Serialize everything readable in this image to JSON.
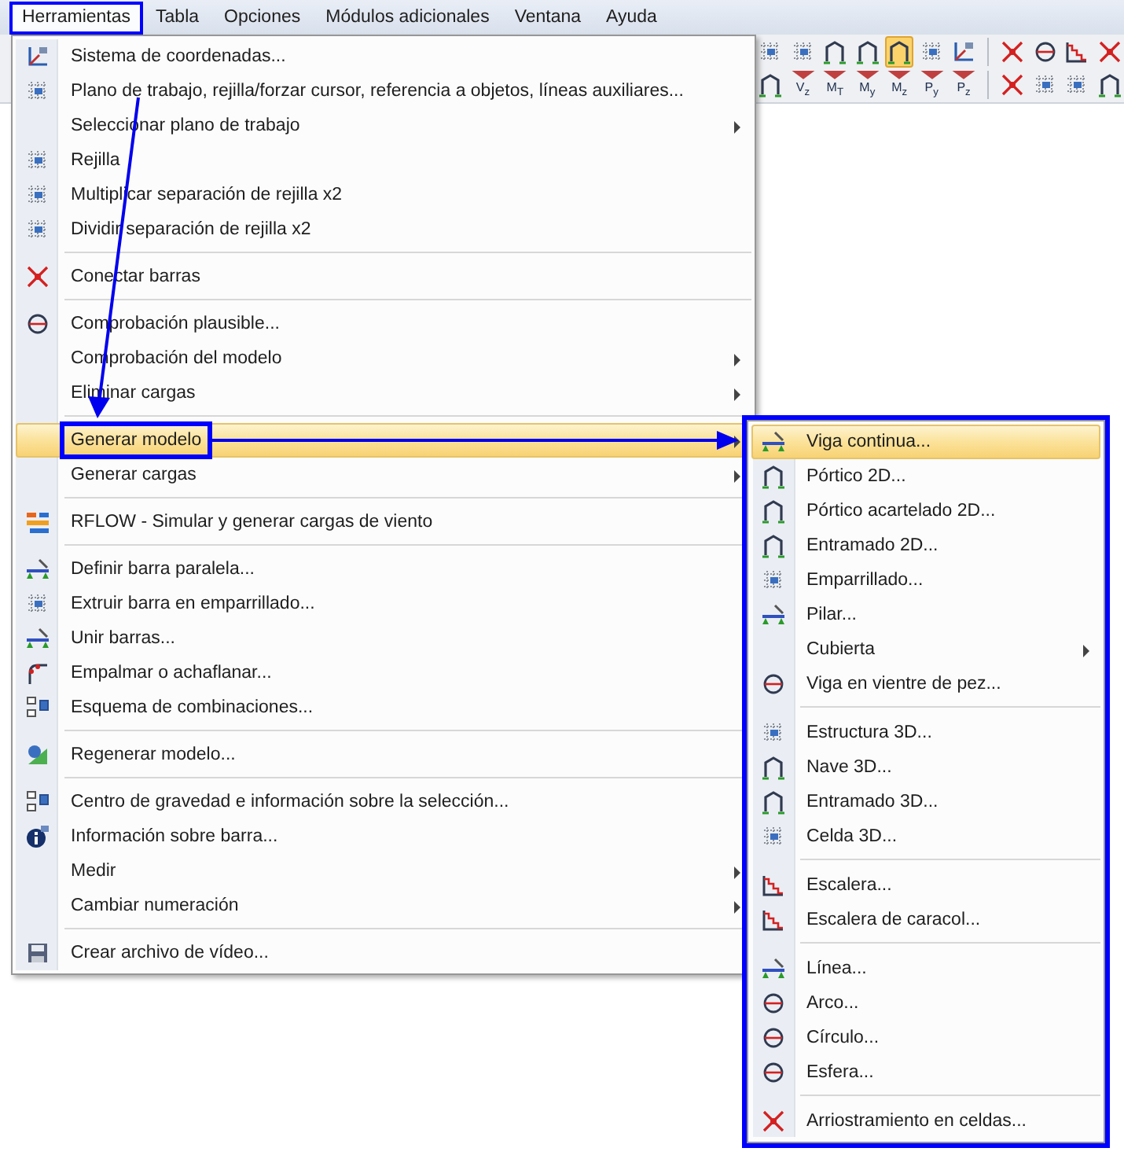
{
  "menubar": [
    {
      "label": "Herramientas",
      "selected": true,
      "framed": true
    },
    {
      "label": "Tabla",
      "selected": false,
      "framed": false
    },
    {
      "label": "Opciones",
      "selected": false,
      "framed": false
    },
    {
      "label": "Módulos adicionales",
      "selected": false,
      "framed": false
    },
    {
      "label": "Ventana",
      "selected": false,
      "framed": false
    },
    {
      "label": "Ayuda",
      "selected": false,
      "framed": false
    }
  ],
  "toolbar": {
    "row_1": [
      {
        "selected": false
      },
      {
        "selected": false
      },
      {
        "selected": false
      },
      {
        "selected": false
      },
      {
        "selected": true
      },
      {
        "selected": false
      },
      {
        "selected": false
      },
      {
        "selected": false
      },
      {
        "selected": false
      },
      {
        "selected": false
      },
      {
        "selected": false
      }
    ],
    "row_2": [
      {
        "kind": "icon",
        "selected": false
      },
      {
        "kind": "label",
        "label": "V$_{z}$",
        "selected": false
      },
      {
        "kind": "label",
        "label": "M$_{T}$",
        "selected": false
      },
      {
        "kind": "label",
        "label": "M$_{y}$",
        "selected": false
      },
      {
        "kind": "label",
        "label": "M$_{z}$",
        "selected": false
      },
      {
        "kind": "label",
        "label": "P$_{y}$",
        "selected": false
      },
      {
        "kind": "label",
        "label": "P$_{z}$",
        "selected": false
      },
      {
        "kind": "icon",
        "selected": false
      },
      {
        "kind": "icon",
        "selected": false
      },
      {
        "kind": "icon",
        "selected": false
      },
      {
        "kind": "icon",
        "selected": false
      }
    ]
  },
  "menu": {
    "items": [
      {
        "kind": "item",
        "label": "Sistema de coordenadas...",
        "submenu": false,
        "selected": false,
        "framed": false
      },
      {
        "kind": "item",
        "label": "Plano de trabajo, rejilla/forzar cursor, referencia a objetos, líneas auxiliares...",
        "submenu": false,
        "selected": false,
        "framed": false
      },
      {
        "kind": "item",
        "label": "Seleccionar plano de trabajo",
        "submenu": true,
        "selected": false,
        "framed": false
      },
      {
        "kind": "item",
        "label": "Rejilla",
        "submenu": false,
        "selected": false,
        "framed": false
      },
      {
        "kind": "item",
        "label": "Multiplicar separación de rejilla x2",
        "submenu": false,
        "selected": false,
        "framed": false
      },
      {
        "kind": "item",
        "label": "Dividir separación de rejilla x2",
        "submenu": false,
        "selected": false,
        "framed": false
      },
      {
        "kind": "separator"
      },
      {
        "kind": "item",
        "label": "Conectar barras",
        "submenu": false,
        "selected": false,
        "framed": false
      },
      {
        "kind": "separator"
      },
      {
        "kind": "item",
        "label": "Comprobación plausible...",
        "submenu": false,
        "selected": false,
        "framed": false
      },
      {
        "kind": "item",
        "label": "Comprobación del modelo",
        "submenu": true,
        "selected": false,
        "framed": false
      },
      {
        "kind": "item",
        "label": "Eliminar cargas",
        "submenu": true,
        "selected": false,
        "framed": false
      },
      {
        "kind": "separator"
      },
      {
        "kind": "item",
        "label": "Generar modelo",
        "submenu": true,
        "selected": true,
        "framed": true
      },
      {
        "kind": "item",
        "label": "Generar cargas",
        "submenu": true,
        "selected": false,
        "framed": false
      },
      {
        "kind": "separator"
      },
      {
        "kind": "item",
        "label": "RFLOW - Simular y generar cargas de viento",
        "submenu": false,
        "selected": false,
        "framed": false
      },
      {
        "kind": "separator"
      },
      {
        "kind": "item",
        "label": "Definir barra paralela...",
        "submenu": false,
        "selected": false,
        "framed": false
      },
      {
        "kind": "item",
        "label": "Extruir barra en emparrillado...",
        "submenu": false,
        "selected": false,
        "framed": false
      },
      {
        "kind": "item",
        "label": "Unir barras...",
        "submenu": false,
        "selected": false,
        "framed": false
      },
      {
        "kind": "item",
        "label": "Empalmar o achaflanar...",
        "submenu": false,
        "selected": false,
        "framed": false
      },
      {
        "kind": "item",
        "label": "Esquema de combinaciones...",
        "submenu": false,
        "selected": false,
        "framed": false
      },
      {
        "kind": "separator"
      },
      {
        "kind": "item",
        "label": "Regenerar modelo...",
        "submenu": false,
        "selected": false,
        "framed": false
      },
      {
        "kind": "separator"
      },
      {
        "kind": "item",
        "label": "Centro de gravedad e información sobre la selección...",
        "submenu": false,
        "selected": false,
        "framed": false
      },
      {
        "kind": "item",
        "label": "Información sobre barra...",
        "submenu": false,
        "selected": false,
        "framed": false
      },
      {
        "kind": "item",
        "label": "Medir",
        "submenu": true,
        "selected": false,
        "framed": false
      },
      {
        "kind": "item",
        "label": "Cambiar numeración",
        "submenu": true,
        "selected": false,
        "framed": false
      },
      {
        "kind": "separator"
      },
      {
        "kind": "item",
        "label": "Crear archivo de vídeo...",
        "submenu": false,
        "selected": false,
        "framed": false
      }
    ]
  },
  "submenu": {
    "framed": true,
    "items": [
      {
        "kind": "item",
        "label": "Viga continua...",
        "submenu": false,
        "selected": true
      },
      {
        "kind": "item",
        "label": "Pórtico 2D...",
        "submenu": false,
        "selected": false
      },
      {
        "kind": "item",
        "label": "Pórtico acartelado 2D...",
        "submenu": false,
        "selected": false
      },
      {
        "kind": "item",
        "label": "Entramado 2D...",
        "submenu": false,
        "selected": false
      },
      {
        "kind": "item",
        "label": "Emparrillado...",
        "submenu": false,
        "selected": false
      },
      {
        "kind": "item",
        "label": "Pilar...",
        "submenu": false,
        "selected": false
      },
      {
        "kind": "item",
        "label": "Cubierta",
        "submenu": true,
        "selected": false
      },
      {
        "kind": "item",
        "label": "Viga en vientre de pez...",
        "submenu": false,
        "selected": false
      },
      {
        "kind": "separator"
      },
      {
        "kind": "item",
        "label": "Estructura 3D...",
        "submenu": false,
        "selected": false
      },
      {
        "kind": "item",
        "label": "Nave 3D...",
        "submenu": false,
        "selected": false
      },
      {
        "kind": "item",
        "label": "Entramado 3D...",
        "submenu": false,
        "selected": false
      },
      {
        "kind": "item",
        "label": "Celda 3D...",
        "submenu": false,
        "selected": false
      },
      {
        "kind": "separator"
      },
      {
        "kind": "item",
        "label": "Escalera...",
        "submenu": false,
        "selected": false
      },
      {
        "kind": "item",
        "label": "Escalera de caracol...",
        "submenu": false,
        "selected": false
      },
      {
        "kind": "separator"
      },
      {
        "kind": "item",
        "label": "Línea...",
        "submenu": false,
        "selected": false
      },
      {
        "kind": "item",
        "label": "Arco...",
        "submenu": false,
        "selected": false
      },
      {
        "kind": "item",
        "label": "Círculo...",
        "submenu": false,
        "selected": false
      },
      {
        "kind": "item",
        "label": "Esfera...",
        "submenu": false,
        "selected": false
      },
      {
        "kind": "separator"
      },
      {
        "kind": "item",
        "label": "Arriostramiento en celdas...",
        "submenu": false,
        "selected": false
      }
    ]
  }
}
